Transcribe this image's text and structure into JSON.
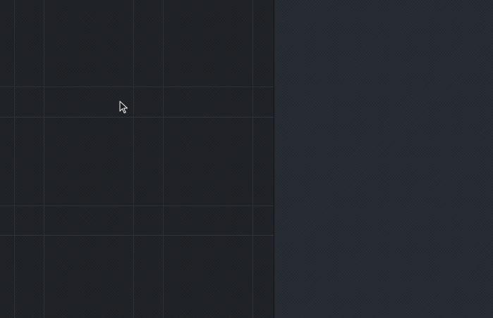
{
  "window": {
    "title": ""
  },
  "canvas": {
    "description_label": ""
  },
  "side_panel": {
    "title": ""
  },
  "cursor": {
    "icon": "arrow-pointer-icon"
  },
  "colors": {
    "canvas_background": "#1f2226",
    "side_panel_background": "#272b32",
    "grid_line": "#2b2f36",
    "divider": "#111316"
  }
}
